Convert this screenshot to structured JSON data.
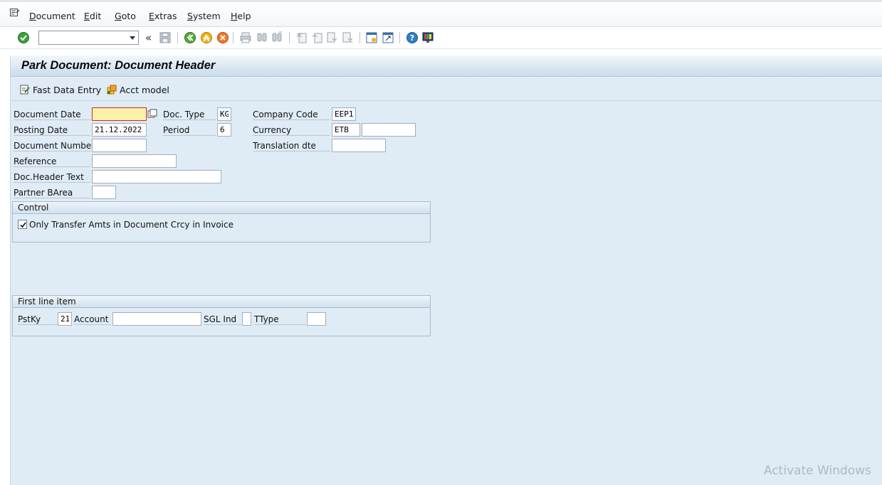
{
  "menu": {
    "items": [
      "Document",
      "Edit",
      "Goto",
      "Extras",
      "System",
      "Help"
    ]
  },
  "toolbar": {
    "command_value": ""
  },
  "screen": {
    "title": "Park Document: Document Header",
    "app_buttons": {
      "fast_data_entry": "Fast Data Entry",
      "acct_model": "Acct model"
    }
  },
  "header_fields": {
    "document_date": {
      "label": "Document Date",
      "value": ""
    },
    "posting_date": {
      "label": "Posting Date",
      "value": "21.12.2022"
    },
    "document_number": {
      "label": "Document Number",
      "value": ""
    },
    "reference": {
      "label": "Reference",
      "value": ""
    },
    "doc_header_text": {
      "label": "Doc.Header Text",
      "value": ""
    },
    "partner_barea": {
      "label": "Partner BArea",
      "value": ""
    },
    "doc_type": {
      "label": "Doc. Type",
      "value": "KG"
    },
    "period": {
      "label": "Period",
      "value": "6"
    },
    "company_code": {
      "label": "Company Code",
      "value": "EEP1"
    },
    "currency": {
      "label": "Currency",
      "value": "ETB",
      "extra_value": ""
    },
    "translation_dte": {
      "label": "Translation dte",
      "value": ""
    }
  },
  "control_group": {
    "title": "Control",
    "checkbox_label": "Only Transfer Amts in Document Crcy in Invoice",
    "checked": true
  },
  "first_line_item": {
    "title": "First line item",
    "pstky_label": "PstKy",
    "pstky_value": "21",
    "account_label": "Account",
    "account_value": "",
    "sgl_ind_label": "SGL Ind",
    "sgl_ind_value": "",
    "ttype_label": "TType",
    "ttype_value": ""
  },
  "watermark": {
    "text": "Activate Windows"
  },
  "colors": {
    "screen_bg": "#dfebf5",
    "active_field": "#fff2a8",
    "active_border": "#c72b2b"
  }
}
